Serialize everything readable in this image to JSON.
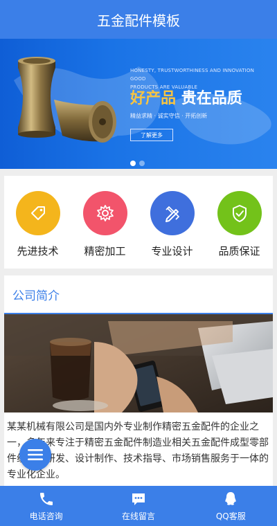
{
  "header": {
    "title": "五金配件模板"
  },
  "banner": {
    "tagline_en_1": "HONESTY, TRUSTWORTHINESS AND INNOVATION GOOD",
    "tagline_en_2": "PRODUCTS ARE VALUABLE",
    "title_part1": "好产品",
    "title_part2": "贵在品质",
    "subtitle": "精益求精 · 诚实守信 · 开拓创新",
    "more_button": "了解更多",
    "slides_total": 2,
    "slide_active": 1,
    "colors": {
      "accent": "#f6c443",
      "bg": "#1a73e6"
    }
  },
  "features": [
    {
      "label": "先进技术",
      "icon": "tag-icon",
      "color": "#f4b51c"
    },
    {
      "label": "精密加工",
      "icon": "gear-icon",
      "color": "#f2546b"
    },
    {
      "label": "专业设计",
      "icon": "design-tools-icon",
      "color": "#3f6fdd"
    },
    {
      "label": "品质保证",
      "icon": "shield-check-icon",
      "color": "#73c21a"
    }
  ],
  "about": {
    "heading": "公司简介",
    "text": "某某机械有限公司是国内外专业制作精密五金配件的企业之一，多年来专注于精密五金配件制造业相关五金配件成型零部件组件的研发、设计制作、技术指导、市场销售服务于一体的专业化企业。"
  },
  "footer": [
    {
      "label": "电话咨询",
      "icon": "phone-icon"
    },
    {
      "label": "在线留言",
      "icon": "message-icon"
    },
    {
      "label": "QQ客服",
      "icon": "qq-icon"
    }
  ],
  "fab": {
    "icon": "menu-icon"
  },
  "colors": {
    "primary": "#3b7fe8"
  }
}
